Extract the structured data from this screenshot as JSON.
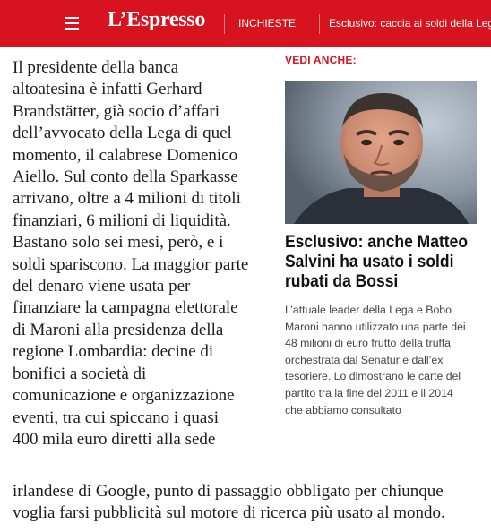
{
  "header": {
    "logo": "L’Espresso",
    "nav_inchieste": "INCHIESTE",
    "nav_exclusive": "Esclusivo: caccia ai soldi della Lega",
    "brand_color": "#d6131f"
  },
  "article": {
    "lines": [
      "Il presidente della banca",
      "altoatesina è infatti Gerhard",
      "Brandstätter, già socio d’affari",
      "dell’avvocato della Lega di quel",
      "momento, il calabrese Domenico",
      "Aiello. Sul conto della Sparkasse",
      "arrivano, oltre a 4 milioni di titoli",
      "finanziari, 6 milioni di liquidità.",
      "Bastano solo sei mesi, però, e i",
      "soldi spariscono. La maggior parte",
      "del denaro viene usata per",
      "finanziare la campagna elettorale",
      "di Maroni alla presidenza della",
      "regione Lombardia: decine di",
      "bonifici a società di",
      "comunicazione e organizzazione",
      "eventi, tra cui spiccano i quasi",
      "400 mila euro diretti alla sede"
    ],
    "cont_lines": [
      "irlandese di Google, punto di passaggio obbligato per chiunque",
      "voglia farsi pubblicità sul motore di ricerca più usato al mondo."
    ]
  },
  "aside": {
    "label": "VEDI ANCHE:",
    "headline_lines": [
      "Esclusivo: anche Matteo",
      "Salvini ha usato i soldi",
      "rubati da Bossi"
    ],
    "summary_lines": [
      "L’attuale leader della Lega e Bobo",
      "Maroni hanno utilizzato una parte dei",
      "48 milioni di euro frutto della truffa",
      "orchestrata dal Senatur e dall’ex",
      "tesoriere. Lo dimostrano le carte del",
      "partito tra la fine del 2011 e il 2014",
      "che abbiamo consultato"
    ]
  }
}
